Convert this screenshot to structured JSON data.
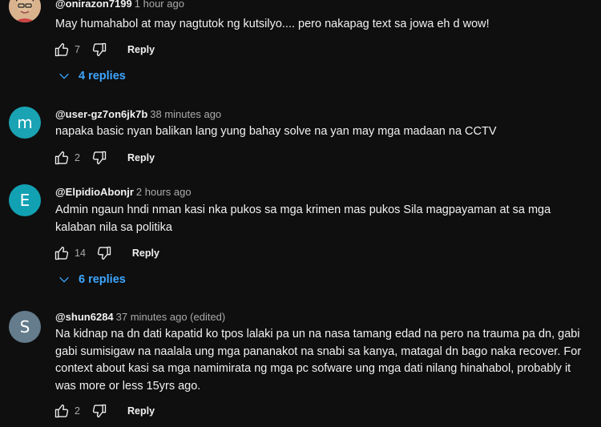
{
  "comments": [
    {
      "handle": "@onirazon7199",
      "time": "1 hour ago",
      "text": "May humahabol at may nagtutok ng kutsilyo.... pero nakapag text sa jowa eh d wow!",
      "likes": "7",
      "reply_label": "Reply",
      "replies_label": "4 replies",
      "avatar_icon": "person-photo-avatar"
    },
    {
      "handle": "@user-gz7on6jk7b",
      "time": "38 minutes ago",
      "text": "napaka basic nyan balikan lang yung bahay solve na yan may mga madaan na CCTV",
      "likes": "2",
      "reply_label": "Reply",
      "avatar_letter": "m",
      "avatar_color": "#1aa3b3"
    },
    {
      "handle": "@ElpidioAbonjr",
      "time": "2 hours ago",
      "text": "Admin ngaun hndi nman kasi nka pukos sa mga krimen mas pukos Sila magpayaman at sa mga kalaban nila sa politika",
      "likes": "14",
      "reply_label": "Reply",
      "replies_label": "6 replies",
      "avatar_letter": "E",
      "avatar_color": "#12a1b3"
    },
    {
      "handle": "@shun6284",
      "time": "37 minutes ago (edited)",
      "text": "Na kidnap na dn dati kapatid ko tpos lalaki pa un na nasa tamang edad na pero na trauma pa dn, gabi gabi sumisigaw na naalala ung mga pananakot na snabi sa kanya, matagal dn bago naka recover. For context about kasi sa mga namimirata ng mga pc sofware ung mga dati nilang hinahabol, probably it was more or less 15yrs ago.",
      "likes": "2",
      "reply_label": "Reply",
      "avatar_letter": "S",
      "avatar_color": "#647c8c"
    }
  ],
  "icons": {
    "like": "thumbs-up-icon",
    "dislike": "thumbs-down-icon",
    "expand": "chevron-down-icon"
  }
}
